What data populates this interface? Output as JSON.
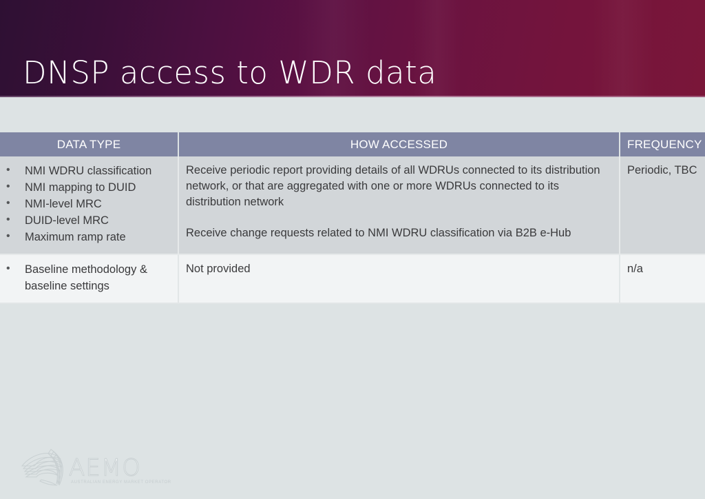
{
  "slide": {
    "title": "DNSP access to WDR data",
    "background_color": "#dde3e4",
    "header_gradient_from": "#2e1033",
    "header_gradient_to": "#7a1639"
  },
  "table": {
    "header_bg": "#7f85a3",
    "headers": {
      "data_type": "DATA TYPE",
      "how_accessed": "HOW ACCESSED",
      "frequency": "FREQUENCY"
    },
    "rows": [
      {
        "data_type_bullets": [
          "NMI WDRU classification",
          "NMI mapping to DUID",
          "NMI-level MRC",
          "DUID-level MRC",
          "Maximum ramp rate"
        ],
        "how_accessed_paragraphs": [
          "Receive periodic report providing details of all WDRUs connected to its distribution network, or that are aggregated with one or more WDRUs connected to its distribution network",
          "Receive change requests related to NMI WDRU classification via B2B e-Hub"
        ],
        "frequency": "Periodic, TBC"
      },
      {
        "data_type_bullets": [
          "Baseline methodology & baseline settings"
        ],
        "how_accessed_paragraphs": [
          "Not provided"
        ],
        "frequency": "n/a"
      }
    ]
  },
  "logo": {
    "wordmark": "AEMO",
    "tagline": "AUSTRALIAN ENERGY MARKET OPERATOR"
  }
}
